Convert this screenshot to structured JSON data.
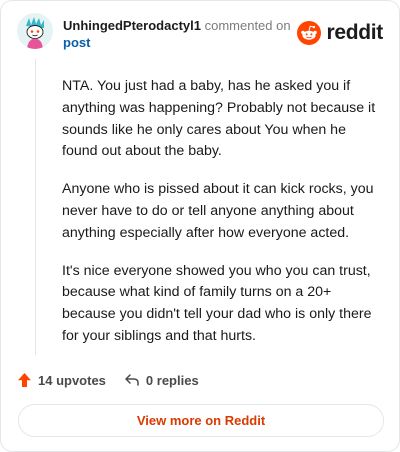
{
  "header": {
    "username": "UnhingedPterodactyl1",
    "action_text": "commented on",
    "post_link": "post",
    "brand_name": "reddit",
    "avatar_icon": "snoo-avatar-icon",
    "brand_icon": "reddit-logo-icon"
  },
  "comment": {
    "paragraphs": [
      "NTA. You just had a baby, has he asked you if anything was happening? Probably not because it sounds like he only cares about You when he found out about the baby.",
      "Anyone who is pissed about it can kick rocks, you never have to do or tell anyone anything about anything especially after how everyone acted.",
      "It's nice everyone showed you who you can trust, because what kind of family turns on a 20+ because you didn't tell your dad who is only there for your siblings and that hurts."
    ]
  },
  "actions": {
    "upvotes": "14 upvotes",
    "replies": "0 replies",
    "upvote_icon": "upvote-arrow-icon",
    "reply_icon": "reply-arrow-icon"
  },
  "footer": {
    "view_more": "View more on Reddit"
  },
  "colors": {
    "accent": "#ff4500",
    "link": "#0a5ea8",
    "cta": "#d93a00"
  }
}
